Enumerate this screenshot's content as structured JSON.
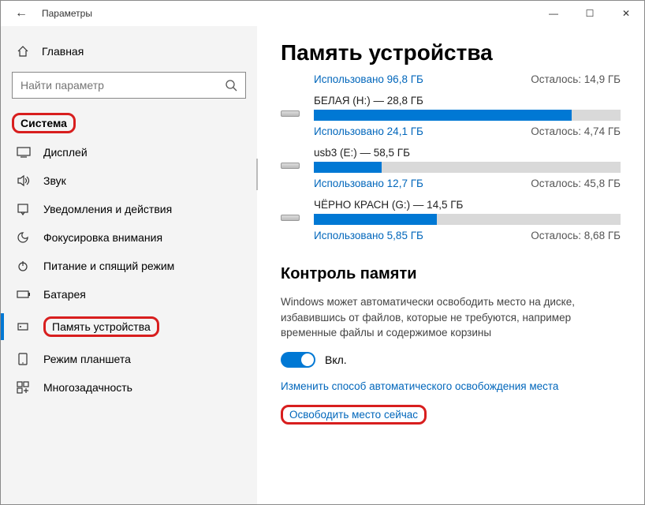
{
  "window": {
    "title": "Параметры"
  },
  "sidebar": {
    "home": "Главная",
    "search_placeholder": "Найти параметр",
    "section": "Система",
    "items": [
      {
        "label": "Дисплей"
      },
      {
        "label": "Звук"
      },
      {
        "label": "Уведомления и действия"
      },
      {
        "label": "Фокусировка внимания"
      },
      {
        "label": "Питание и спящий режим"
      },
      {
        "label": "Батарея"
      },
      {
        "label": "Память устройства"
      },
      {
        "label": "Режим планшета"
      },
      {
        "label": "Многозадачность"
      }
    ]
  },
  "page": {
    "title": "Память устройства",
    "drives": [
      {
        "title": "",
        "used_label": "Использовано 96,8 ГБ",
        "free_label": "Осталось: 14,9 ГБ",
        "pct": 0
      },
      {
        "title": "БЕЛАЯ (H:) — 28,8 ГБ",
        "used_label": "Использовано 24,1 ГБ",
        "free_label": "Осталось: 4,74 ГБ",
        "pct": 84
      },
      {
        "title": "usb3 (E:) — 58,5 ГБ",
        "used_label": "Использовано 12,7 ГБ",
        "free_label": "Осталось: 45,8 ГБ",
        "pct": 22
      },
      {
        "title": "ЧЁРНО КРАСН (G:) — 14,5 ГБ",
        "used_label": "Использовано 5,85 ГБ",
        "free_label": "Осталось: 8,68 ГБ",
        "pct": 40
      }
    ],
    "sense_heading": "Контроль памяти",
    "sense_desc": "Windows может автоматически освободить место на диске, избавившись от файлов, которые не требуются, например временные файлы и содержимое корзины",
    "toggle_label": "Вкл.",
    "link_change": "Изменить способ автоматического освобождения места",
    "link_free": "Освободить место сейчас"
  }
}
